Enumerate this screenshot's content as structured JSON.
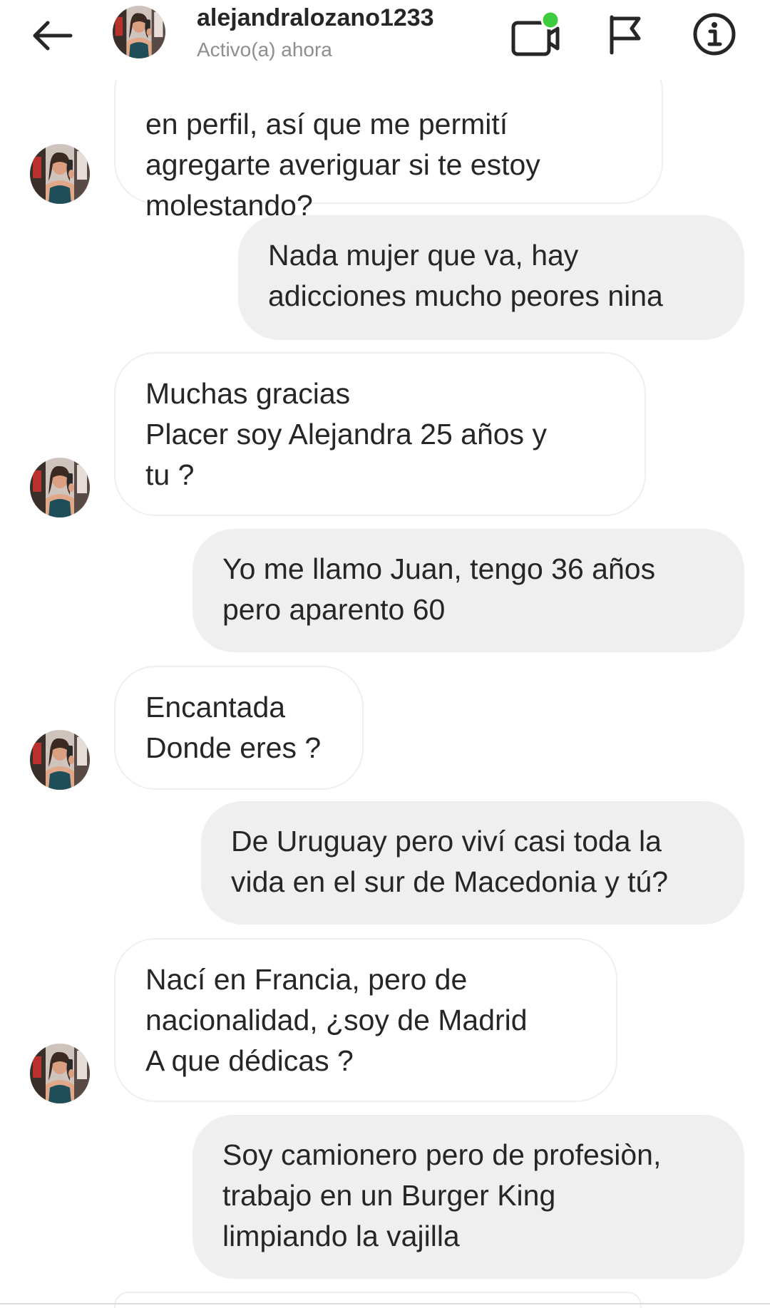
{
  "header": {
    "username": "alejandralozano1233",
    "status": "Activo(a) ahora",
    "back_icon": "arrow-left-icon",
    "video_icon": "video-call-icon",
    "flag_icon": "flag-icon",
    "info_icon": "info-icon",
    "online_color": "#3ecb3e"
  },
  "messages": [
    {
      "sender": "them",
      "text": "en perfil, así que me permití\nagregarte averiguar si te estoy\nmolestando?"
    },
    {
      "sender": "me",
      "text": "Nada mujer que va, hay\nadicciones mucho peores nina"
    },
    {
      "sender": "them",
      "text": "Muchas gracias\nPlacer soy  Alejandra  25 años y\ntu ?"
    },
    {
      "sender": "me",
      "text": "Yo me llamo Juan, tengo 36 años\npero aparento 60"
    },
    {
      "sender": "them",
      "text": "Encantada\nDonde eres ?"
    },
    {
      "sender": "me",
      "text": "De Uruguay pero viví casi toda la\nvida en el sur de Macedonia y tú?"
    },
    {
      "sender": "them",
      "text": "Nací en Francia, pero de\nnacionalidad, ¿soy de Madrid\nA que dédicas ?"
    },
    {
      "sender": "me",
      "text": "Soy camionero pero de profesiòn,\ntrabajo en un Burger King\nlimpiando la vajilla"
    }
  ],
  "colors": {
    "incoming_bubble_bg": "#ffffff",
    "incoming_bubble_border": "#efefef",
    "outgoing_bubble_bg": "#efefef",
    "text": "#262626",
    "muted": "#8e8e8e"
  }
}
